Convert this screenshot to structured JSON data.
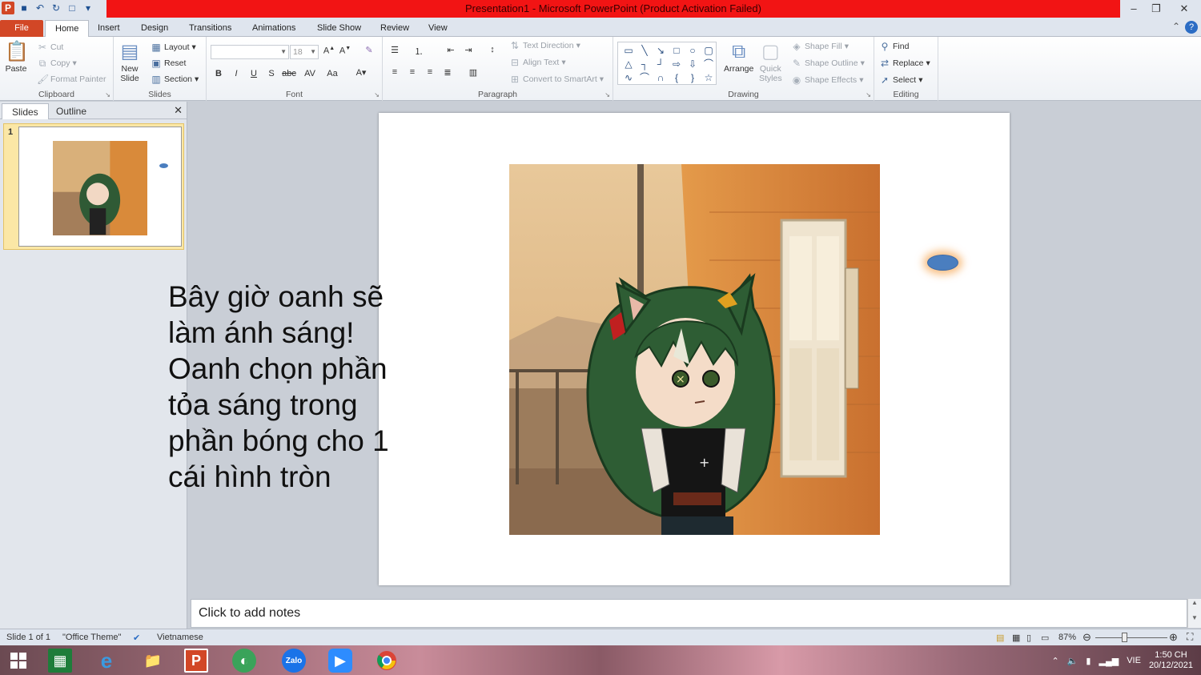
{
  "window": {
    "title": "Presentation1 - Microsoft PowerPoint (Product Activation Failed)"
  },
  "tabs": [
    "File",
    "Home",
    "Insert",
    "Design",
    "Transitions",
    "Animations",
    "Slide Show",
    "Review",
    "View"
  ],
  "ribbon": {
    "clipboard": {
      "label": "Clipboard",
      "paste": "Paste",
      "cut": "Cut",
      "copy": "Copy",
      "format_painter": "Format Painter"
    },
    "slides": {
      "label": "Slides",
      "new_slide_line1": "New",
      "new_slide_line2": "Slide",
      "layout": "Layout",
      "reset": "Reset",
      "section": "Section"
    },
    "font": {
      "label": "Font",
      "font_name": "",
      "font_size": "18"
    },
    "paragraph": {
      "label": "Paragraph",
      "text_direction": "Text Direction",
      "align_text": "Align Text",
      "convert_smartart": "Convert to SmartArt"
    },
    "drawing": {
      "label": "Drawing",
      "arrange": "Arrange",
      "quick_styles_line1": "Quick",
      "quick_styles_line2": "Styles",
      "shape_fill": "Shape Fill",
      "shape_outline": "Shape Outline",
      "shape_effects": "Shape Effects"
    },
    "editing": {
      "label": "Editing",
      "find": "Find",
      "replace": "Replace",
      "select": "Select"
    }
  },
  "left_pane": {
    "tab_slides": "Slides",
    "tab_outline": "Outline",
    "slide_number": "1"
  },
  "slide": {
    "text": "Bây giờ oanh sẽ làm ánh sáng! Oanh chọn phần tỏa sáng trong phần bóng cho 1 cái hình tròn"
  },
  "notes": {
    "placeholder": "Click to add notes"
  },
  "status": {
    "slide_info": "Slide 1 of 1",
    "theme": "\"Office Theme\"",
    "language": "Vietnamese",
    "zoom": "87%",
    "zoom_fraction": 0.4
  },
  "taskbar": {
    "apps": [
      "windows-start",
      "excel",
      "internet-explorer",
      "file-explorer",
      "powerpoint",
      "coc-coc",
      "zalo",
      "zoom",
      "chrome"
    ],
    "zalo_label": "Zalo",
    "lang": "VIE",
    "time": "1:50 CH",
    "date": "20/12/2021"
  },
  "colors": {
    "titlebar_red": "#f21414",
    "file_tab": "#d24726",
    "oval_fill": "#4a7ebf",
    "oval_glow": "#f5aa5a"
  }
}
